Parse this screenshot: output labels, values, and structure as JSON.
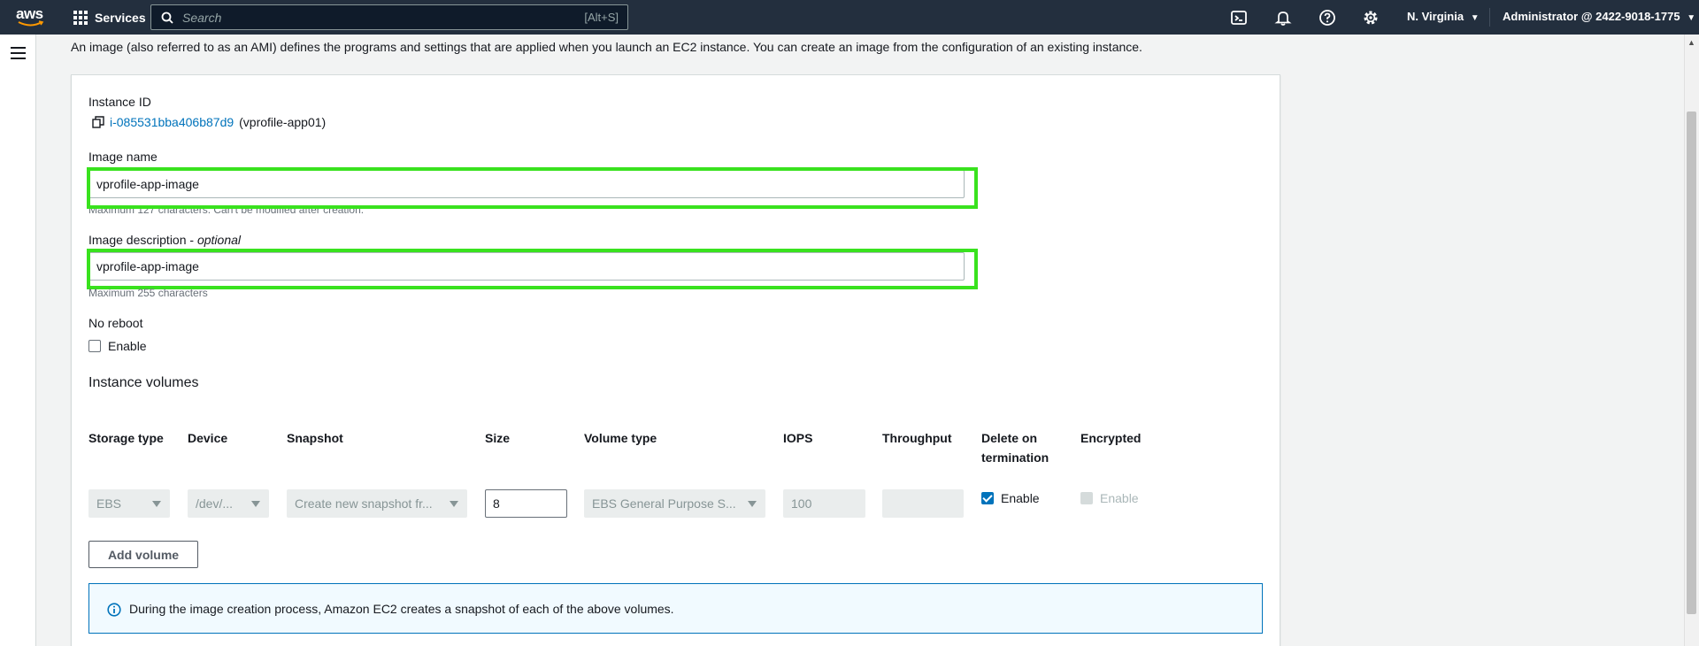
{
  "nav": {
    "logo": "aws",
    "services": "Services",
    "search_placeholder": "Search",
    "search_shortcut": "[Alt+S]",
    "region": "N. Virginia",
    "account": "Administrator @ 2422-9018-1775",
    "icons": [
      "cloudshell-icon",
      "bell-icon",
      "help-icon",
      "gear-icon"
    ]
  },
  "intro": "An image (also referred to as an AMI) defines the programs and settings that are applied when you launch an EC2 instance. You can create an image from the configuration of an existing instance.",
  "instance": {
    "label": "Instance ID",
    "id": "i-085531bba406b87d9",
    "name": "(vprofile-app01)"
  },
  "image_name": {
    "label": "Image name",
    "value": "vprofile-app-image",
    "hint": "Maximum 127 characters. Can't be modified after creation."
  },
  "image_description": {
    "label": "Image description",
    "label_suffix": "optional",
    "value": "vprofile-app-image",
    "hint": "Maximum 255 characters"
  },
  "no_reboot": {
    "label": "No reboot",
    "option": "Enable",
    "checked": false
  },
  "volumes": {
    "title": "Instance volumes",
    "columns": [
      "Storage type",
      "Device",
      "Snapshot",
      "Size",
      "Volume type",
      "IOPS",
      "Throughput",
      "Delete on termination",
      "Encrypted"
    ],
    "rows": [
      {
        "storage_type": "EBS",
        "device": "/dev/...",
        "snapshot": "Create new snapshot fr...",
        "size": "8",
        "volume_type": "EBS General Purpose S...",
        "iops": "100",
        "throughput": "",
        "delete_on_termination": "Enable",
        "encrypted": "Enable"
      }
    ],
    "add_button": "Add volume"
  },
  "info": "During the image creation process, Amazon EC2 creates a snapshot of each of the above volumes.",
  "colors": {
    "nav_bg": "#232f3e",
    "link": "#0073bb",
    "highlight": "#39e21e",
    "info_border": "#0073bb"
  }
}
